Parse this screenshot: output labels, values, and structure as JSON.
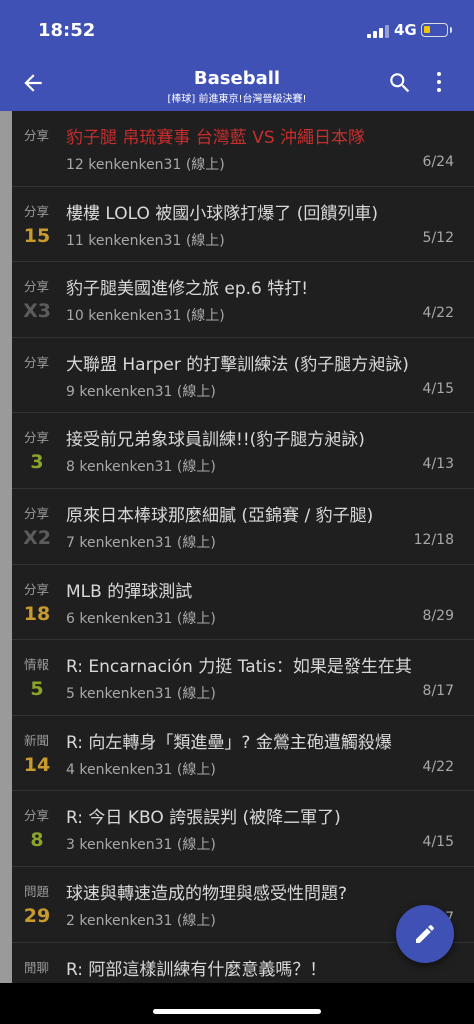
{
  "status": {
    "time": "18:52",
    "network": "4G"
  },
  "header": {
    "title": "Baseball",
    "subtitle": "[棒球] 前進東京!台灣晉級決賽!"
  },
  "colors": {
    "primary": "#3f51b5",
    "push_orange": "#c99a2e",
    "push_green": "#8aa52a",
    "title_red": "#c62e2e"
  },
  "posts": [
    {
      "category": "分享",
      "push": "",
      "title": "豹子腿 帛琉賽事 台灣藍 VS 沖繩日本隊",
      "meta": "12   kenkenken31 (線上)",
      "date": "6/24"
    },
    {
      "category": "分享",
      "push": "15",
      "title": "樓樓 LOLO 被國小球隊打爆了 (回饋列車)",
      "meta": "11   kenkenken31 (線上)",
      "date": "5/12"
    },
    {
      "category": "分享",
      "push": "X3",
      "title": "豹子腿美國進修之旅 ep.6 特打!",
      "meta": "10   kenkenken31 (線上)",
      "date": "4/22"
    },
    {
      "category": "分享",
      "push": "",
      "title": "大聯盟 Harper 的打擊訓練法 (豹子腿方昶詠)",
      "meta": "9   kenkenken31 (線上)",
      "date": "4/15"
    },
    {
      "category": "分享",
      "push": "3",
      "title": "接受前兄弟象球員訓練!!(豹子腿方昶詠)",
      "meta": "8   kenkenken31 (線上)",
      "date": "4/13"
    },
    {
      "category": "分享",
      "push": "X2",
      "title": "原來日本棒球那麼細膩 (亞錦賽 / 豹子腿)",
      "meta": "7   kenkenken31 (線上)",
      "date": "12/18"
    },
    {
      "category": "分享",
      "push": "18",
      "title": "MLB 的彈球測試",
      "meta": "6   kenkenken31 (線上)",
      "date": "8/29"
    },
    {
      "category": "情報",
      "push": "5",
      "title": "R: Encarnación 力挺 Tatis：如果是發生在其",
      "meta": "5   kenkenken31 (線上)",
      "date": "8/17"
    },
    {
      "category": "新聞",
      "push": "14",
      "title": "R: 向左轉身「類進壘」? 金鶯主砲遭觸殺爆",
      "meta": "4   kenkenken31 (線上)",
      "date": "4/22"
    },
    {
      "category": "分享",
      "push": "8",
      "title": "R: 今日 KBO 誇張誤判 (被降二軍了)",
      "meta": "3   kenkenken31 (線上)",
      "date": "4/15"
    },
    {
      "category": "問題",
      "push": "29",
      "title": "球速與轉速造成的物理與感受性問題?",
      "meta": "2   kenkenken31 (線上)",
      "date": "7"
    },
    {
      "category": "閒聊",
      "push": "",
      "title": "R: 阿部這樣訓練有什麼意義嗎？！",
      "meta": "",
      "date": ""
    }
  ]
}
